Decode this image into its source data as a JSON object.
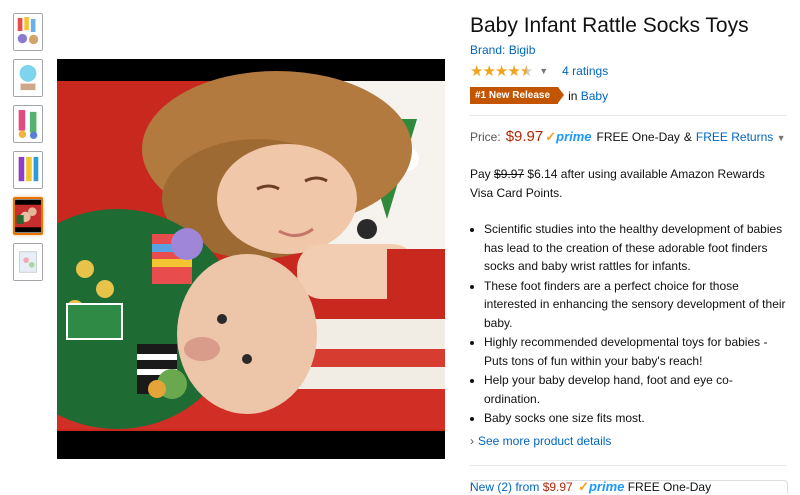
{
  "thumbnails": [
    {
      "name": "thumb-rattle-set",
      "selected": false
    },
    {
      "name": "thumb-socks-blue",
      "selected": false
    },
    {
      "name": "thumb-socks-pair",
      "selected": false
    },
    {
      "name": "thumb-wrist-rattles",
      "selected": false
    },
    {
      "name": "thumb-kids-photo",
      "selected": true
    },
    {
      "name": "thumb-package",
      "selected": false
    }
  ],
  "product": {
    "title": "Baby Infant Rattle Socks Toys",
    "brand_label": "Brand: ",
    "brand_value": "Bigib",
    "stars": "★★★★",
    "stars_half": "★",
    "rating_value": 4.5,
    "ratings_text": "4 ratings",
    "badge": "#1 New Release",
    "category_prefix": "in",
    "category_link": "Baby"
  },
  "price": {
    "label": "Price:",
    "value": "$9.97",
    "prime": "prime",
    "free": "FREE One-Day",
    "amp": "&",
    "free_returns": "FREE Returns"
  },
  "pay": {
    "prefix": "Pay",
    "old": "$9.97",
    "new": "$6.14",
    "rest": "after using available Amazon Rewards Visa Card Points."
  },
  "bullets": [
    "Scientific studies into the healthy development of babies has lead to the creation of these adorable foot finders socks and baby wrist rattles for infants.",
    "These foot finders are a perfect choice for those interested in enhancing the sensory development of their baby.",
    "Highly recommended developmental toys for babies - Puts tons of fun within your baby's reach!",
    "Help your baby develop hand, foot and eye co-ordination.",
    "Baby socks one size fits most."
  ],
  "see_more": "See more product details",
  "new_offer": {
    "text": "New (2) from",
    "price": "$9.97",
    "prime": "prime",
    "free": "FREE One-Day"
  },
  "colors": {
    "accent_orange": "#e77600",
    "link_blue": "#0066c0",
    "price_red": "#b12704",
    "badge_bg": "#c45500",
    "star": "#f0a31d"
  }
}
